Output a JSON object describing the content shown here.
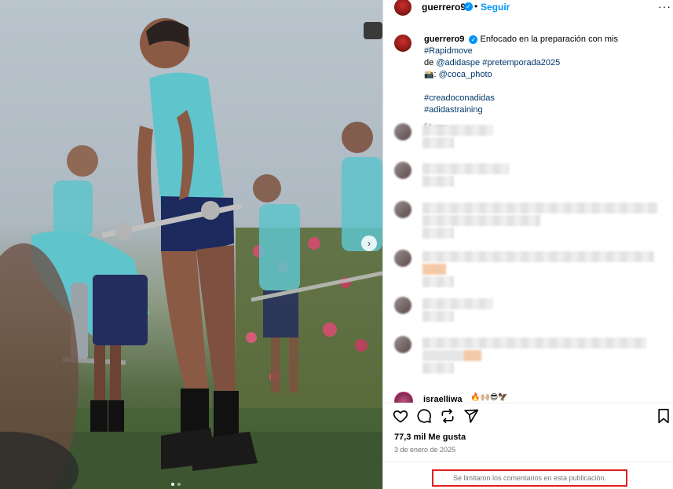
{
  "header": {
    "username": "guerrero9",
    "separator": "•",
    "follow_label": "Seguir",
    "more_label": "···"
  },
  "caption": {
    "username": "guerrero9",
    "text_1": "Enfocado en la preparación con mis",
    "hashtag_rapidmove": "#Rapidmove",
    "text_de": "de",
    "mention_adidaspe": "@adidaspe",
    "hashtag_pretemporada": "#pretemporada2025",
    "camera_emoji": "📸",
    "photo_credit_prefix": ":",
    "mention_photo": "@coca_photo",
    "hashtag_creado": "#creadoconadidas",
    "hashtag_training": "#adidastraining",
    "time": "54 sem"
  },
  "last_comment": {
    "username": "israelliwa",
    "emojis": "🔥🙌🏼😎🦅"
  },
  "post": {
    "likes": "77,3 mil Me gusta",
    "date": "3 de enero de 2025",
    "comments_limited": "Se limitaron los comentarios en esta publicación."
  },
  "icons": {
    "like": "heart-icon",
    "comment": "comment-icon",
    "repost": "repost-icon",
    "share": "share-icon",
    "save": "bookmark-icon",
    "next": "chevron-right-icon",
    "verified": "verified-badge-icon"
  },
  "colors": {
    "accent": "#0095f6",
    "link": "#00376b",
    "highlight_box": "#e0201f",
    "jersey": "#5fc4cc"
  }
}
